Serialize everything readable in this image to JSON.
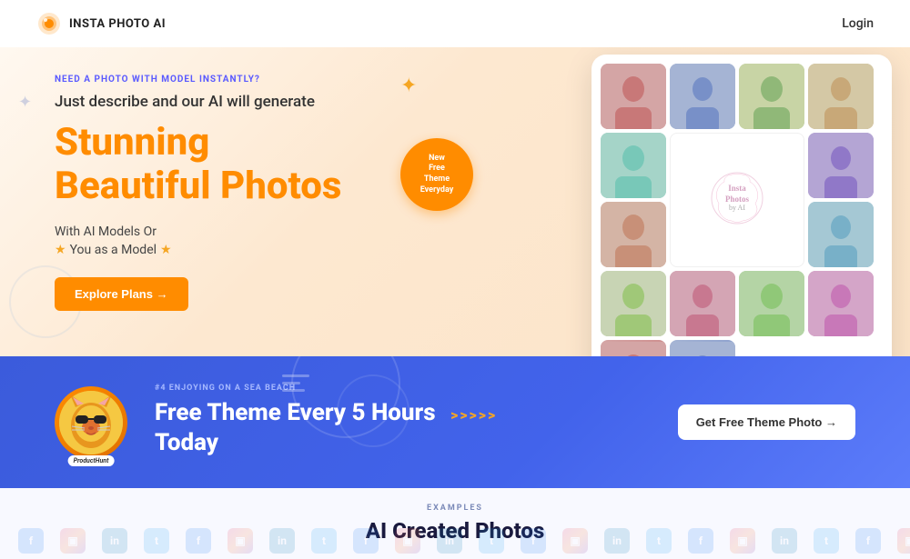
{
  "navbar": {
    "logo_text": "INSTA PHOTO AI",
    "login_label": "Login"
  },
  "hero": {
    "subtitle": "NEED A PHOTO WITH MODEL INSTANTLY?",
    "description": "Just describe and our AI will generate",
    "title_line1": "Stunning",
    "title_line2": "Beautiful Photos",
    "model_text": "With AI Models Or",
    "you_model_text": "You as a Model",
    "explore_btn": "Explore Plans →",
    "badge": {
      "line1": "New",
      "line2": "Free",
      "line3": "Theme",
      "line4": "Everyday"
    },
    "deco_star": "✦"
  },
  "banner": {
    "tag": "#4 ENJOYING ON A SEA BEACH",
    "title_line1": "Free Theme Every 5 Hours",
    "title_line2": "Today",
    "avatar_label": "ProductHunt",
    "get_btn": "Get Free Theme Photo →",
    "arrows": ">>>>>"
  },
  "bottom": {
    "examples_label": "EXAMPLES",
    "ai_title": "AI Created Photos"
  },
  "social_icons": [
    {
      "label": "f",
      "class": "si-fb"
    },
    {
      "label": "in",
      "class": "si-li"
    },
    {
      "label": "ig",
      "class": "si-ig"
    },
    {
      "label": "t",
      "class": "si-tw"
    },
    {
      "label": "f",
      "class": "si-fb"
    },
    {
      "label": "in",
      "class": "si-li"
    },
    {
      "label": "ig",
      "class": "si-ig"
    },
    {
      "label": "t",
      "class": "si-tw"
    },
    {
      "label": "f",
      "class": "si-fb"
    },
    {
      "label": "in",
      "class": "si-li"
    },
    {
      "label": "ig",
      "class": "si-ig"
    },
    {
      "label": "t",
      "class": "si-tw"
    },
    {
      "label": "f",
      "class": "si-fb"
    },
    {
      "label": "in",
      "class": "si-li"
    },
    {
      "label": "ig",
      "class": "si-ig"
    },
    {
      "label": "t",
      "class": "si-tw"
    },
    {
      "label": "f",
      "class": "si-fb"
    },
    {
      "label": "in",
      "class": "si-li"
    },
    {
      "label": "ig",
      "class": "si-ig"
    },
    {
      "label": "t",
      "class": "si-tw"
    },
    {
      "label": "f",
      "class": "si-fb"
    },
    {
      "label": "in",
      "class": "si-li"
    },
    {
      "label": "ig",
      "class": "si-ig"
    },
    {
      "label": "t",
      "class": "si-tw"
    }
  ],
  "photo_cells": [
    {
      "id": 1,
      "color": "c1"
    },
    {
      "id": 2,
      "color": "c2"
    },
    {
      "id": 3,
      "color": "c3"
    },
    {
      "id": 4,
      "color": "c4"
    },
    {
      "id": 5,
      "color": "c5"
    },
    {
      "id": 6,
      "color": "c6"
    },
    {
      "id": 7,
      "color": "c7"
    },
    {
      "id": 8,
      "color": "c8"
    },
    {
      "id": 9,
      "color": "c9"
    },
    {
      "id": 10,
      "color": "c10"
    },
    {
      "id": 11,
      "color": "c11"
    },
    {
      "id": 12,
      "color": "c12"
    }
  ]
}
